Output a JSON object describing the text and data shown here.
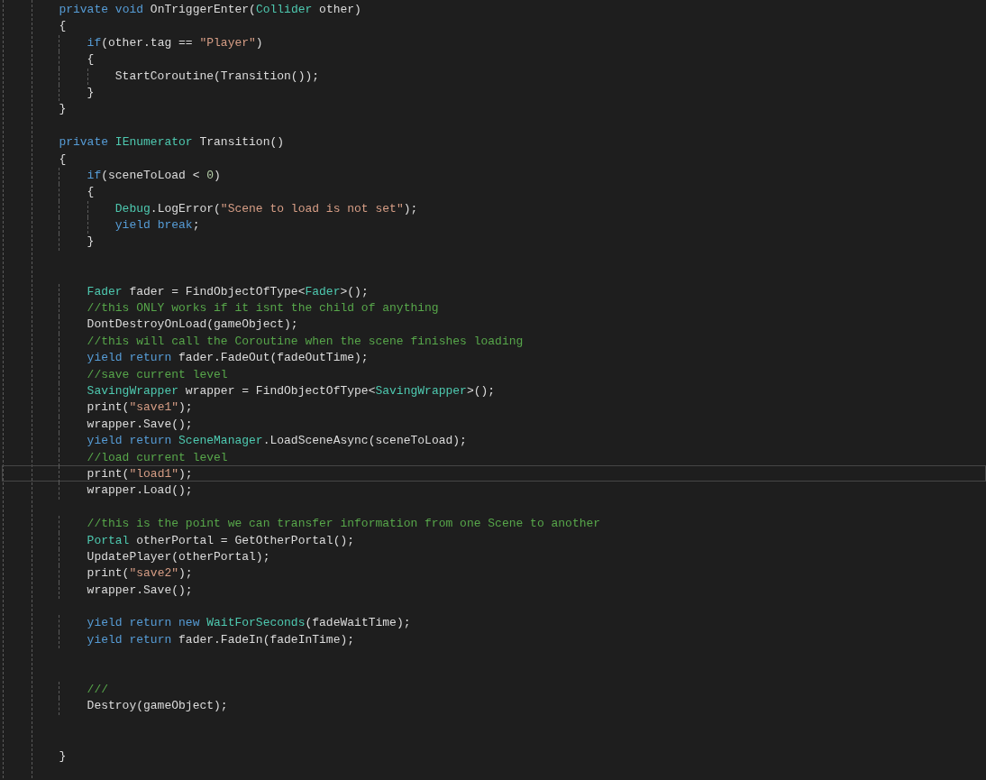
{
  "editor": {
    "lines": [
      {
        "kind": "code",
        "current": false,
        "tokens": [
          {
            "kind": "keyword",
            "text": "        private "
          },
          {
            "kind": "keyword",
            "text": "void"
          },
          {
            "kind": "plain",
            "text": " OnTriggerEnter("
          },
          {
            "kind": "type",
            "text": "Collider"
          },
          {
            "kind": "plain",
            "text": " other)"
          }
        ]
      },
      {
        "kind": "code",
        "current": false,
        "tokens": [
          {
            "kind": "plain",
            "text": "        {"
          }
        ]
      },
      {
        "kind": "code",
        "current": false,
        "tokens": [
          {
            "kind": "keyword",
            "text": "            if"
          },
          {
            "kind": "plain",
            "text": "(other.tag == "
          },
          {
            "kind": "string",
            "text": "\"Player\""
          },
          {
            "kind": "plain",
            "text": ")"
          }
        ]
      },
      {
        "kind": "code",
        "current": false,
        "tokens": [
          {
            "kind": "plain",
            "text": "            {"
          }
        ]
      },
      {
        "kind": "code",
        "current": false,
        "tokens": [
          {
            "kind": "plain",
            "text": "                StartCoroutine(Transition());"
          }
        ]
      },
      {
        "kind": "code",
        "current": false,
        "tokens": [
          {
            "kind": "plain",
            "text": "            }"
          }
        ]
      },
      {
        "kind": "code",
        "current": false,
        "tokens": [
          {
            "kind": "plain",
            "text": "        }"
          }
        ]
      },
      {
        "kind": "blank"
      },
      {
        "kind": "code",
        "current": false,
        "tokens": [
          {
            "kind": "keyword",
            "text": "        private "
          },
          {
            "kind": "type",
            "text": "IEnumerator"
          },
          {
            "kind": "plain",
            "text": " Transition()"
          }
        ]
      },
      {
        "kind": "code",
        "current": false,
        "tokens": [
          {
            "kind": "plain",
            "text": "        {"
          }
        ]
      },
      {
        "kind": "code",
        "current": false,
        "tokens": [
          {
            "kind": "keyword",
            "text": "            if"
          },
          {
            "kind": "plain",
            "text": "(sceneToLoad < "
          },
          {
            "kind": "number",
            "text": "0"
          },
          {
            "kind": "plain",
            "text": ")"
          }
        ]
      },
      {
        "kind": "code",
        "current": false,
        "tokens": [
          {
            "kind": "plain",
            "text": "            {"
          }
        ]
      },
      {
        "kind": "code",
        "current": false,
        "tokens": [
          {
            "kind": "type",
            "text": "                Debug"
          },
          {
            "kind": "plain",
            "text": ".LogError("
          },
          {
            "kind": "string",
            "text": "\"Scene to load is not set\""
          },
          {
            "kind": "plain",
            "text": ");"
          }
        ]
      },
      {
        "kind": "code",
        "current": false,
        "tokens": [
          {
            "kind": "keyword",
            "text": "                yield "
          },
          {
            "kind": "keyword",
            "text": "break"
          },
          {
            "kind": "plain",
            "text": ";"
          }
        ]
      },
      {
        "kind": "code",
        "current": false,
        "tokens": [
          {
            "kind": "plain",
            "text": "            }"
          }
        ]
      },
      {
        "kind": "blank"
      },
      {
        "kind": "blank"
      },
      {
        "kind": "code",
        "current": false,
        "tokens": [
          {
            "kind": "type",
            "text": "            Fader"
          },
          {
            "kind": "plain",
            "text": " fader = FindObjectOfType<"
          },
          {
            "kind": "type",
            "text": "Fader"
          },
          {
            "kind": "plain",
            "text": ">();"
          }
        ]
      },
      {
        "kind": "code",
        "current": false,
        "tokens": [
          {
            "kind": "comment",
            "text": "            //this ONLY works if it isnt the child of anything"
          }
        ]
      },
      {
        "kind": "code",
        "current": false,
        "tokens": [
          {
            "kind": "plain",
            "text": "            DontDestroyOnLoad(gameObject);"
          }
        ]
      },
      {
        "kind": "code",
        "current": false,
        "tokens": [
          {
            "kind": "comment",
            "text": "            //this will call the Coroutine when the scene finishes loading"
          }
        ]
      },
      {
        "kind": "code",
        "current": false,
        "tokens": [
          {
            "kind": "keyword",
            "text": "            yield "
          },
          {
            "kind": "keyword",
            "text": "return"
          },
          {
            "kind": "plain",
            "text": " fader.FadeOut(fadeOutTime);"
          }
        ]
      },
      {
        "kind": "code",
        "current": false,
        "tokens": [
          {
            "kind": "comment",
            "text": "            //save current level"
          }
        ]
      },
      {
        "kind": "code",
        "current": false,
        "tokens": [
          {
            "kind": "type",
            "text": "            SavingWrapper"
          },
          {
            "kind": "plain",
            "text": " wrapper = FindObjectOfType<"
          },
          {
            "kind": "type",
            "text": "SavingWrapper"
          },
          {
            "kind": "plain",
            "text": ">();"
          }
        ]
      },
      {
        "kind": "code",
        "current": false,
        "tokens": [
          {
            "kind": "plain",
            "text": "            print("
          },
          {
            "kind": "string",
            "text": "\"save1\""
          },
          {
            "kind": "plain",
            "text": ");"
          }
        ]
      },
      {
        "kind": "code",
        "current": false,
        "tokens": [
          {
            "kind": "plain",
            "text": "            wrapper.Save();"
          }
        ]
      },
      {
        "kind": "code",
        "current": false,
        "tokens": [
          {
            "kind": "keyword",
            "text": "            yield "
          },
          {
            "kind": "keyword",
            "text": "return "
          },
          {
            "kind": "type",
            "text": "SceneManager"
          },
          {
            "kind": "plain",
            "text": ".LoadSceneAsync(sceneToLoad);"
          }
        ]
      },
      {
        "kind": "code",
        "current": false,
        "tokens": [
          {
            "kind": "comment",
            "text": "            //load current level"
          }
        ]
      },
      {
        "kind": "code",
        "current": true,
        "tokens": [
          {
            "kind": "plain",
            "text": "            print("
          },
          {
            "kind": "string",
            "text": "\"load1\""
          },
          {
            "kind": "plain",
            "text": ");"
          }
        ]
      },
      {
        "kind": "code",
        "current": false,
        "tokens": [
          {
            "kind": "plain",
            "text": "            wrapper.Load();"
          }
        ]
      },
      {
        "kind": "blank"
      },
      {
        "kind": "code",
        "current": false,
        "tokens": [
          {
            "kind": "comment",
            "text": "            //this is the point we can transfer information from one Scene to another"
          }
        ]
      },
      {
        "kind": "code",
        "current": false,
        "tokens": [
          {
            "kind": "type",
            "text": "            Portal"
          },
          {
            "kind": "plain",
            "text": " otherPortal = GetOtherPortal();"
          }
        ]
      },
      {
        "kind": "code",
        "current": false,
        "tokens": [
          {
            "kind": "plain",
            "text": "            UpdatePlayer(otherPortal);"
          }
        ]
      },
      {
        "kind": "code",
        "current": false,
        "tokens": [
          {
            "kind": "plain",
            "text": "            print("
          },
          {
            "kind": "string",
            "text": "\"save2\""
          },
          {
            "kind": "plain",
            "text": ");"
          }
        ]
      },
      {
        "kind": "code",
        "current": false,
        "tokens": [
          {
            "kind": "plain",
            "text": "            wrapper.Save();"
          }
        ]
      },
      {
        "kind": "blank"
      },
      {
        "kind": "code",
        "current": false,
        "tokens": [
          {
            "kind": "keyword",
            "text": "            yield "
          },
          {
            "kind": "keyword",
            "text": "return "
          },
          {
            "kind": "keyword",
            "text": "new "
          },
          {
            "kind": "type",
            "text": "WaitForSeconds"
          },
          {
            "kind": "plain",
            "text": "(fadeWaitTime);"
          }
        ]
      },
      {
        "kind": "code",
        "current": false,
        "tokens": [
          {
            "kind": "keyword",
            "text": "            yield "
          },
          {
            "kind": "keyword",
            "text": "return"
          },
          {
            "kind": "plain",
            "text": " fader.FadeIn(fadeInTime);"
          }
        ]
      },
      {
        "kind": "blank"
      },
      {
        "kind": "blank"
      },
      {
        "kind": "code",
        "current": false,
        "tokens": [
          {
            "kind": "comment",
            "text": "            ///"
          }
        ]
      },
      {
        "kind": "code",
        "current": false,
        "tokens": [
          {
            "kind": "plain",
            "text": "            Destroy(gameObject);"
          }
        ]
      },
      {
        "kind": "blank"
      },
      {
        "kind": "blank"
      },
      {
        "kind": "code",
        "current": false,
        "tokens": [
          {
            "kind": "plain",
            "text": "        }"
          }
        ]
      }
    ]
  }
}
